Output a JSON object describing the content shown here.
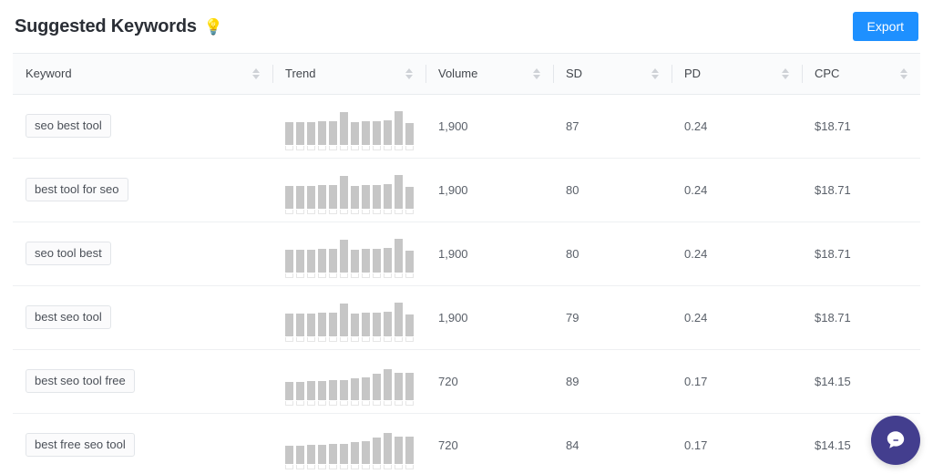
{
  "header": {
    "title": "Suggested Keywords",
    "bulb_icon": "lightbulb-icon",
    "bulb_glyph": "💡",
    "export_label": "Export",
    "export_color": "#1e90ff"
  },
  "table": {
    "columns": [
      {
        "key": "keyword",
        "label": "Keyword",
        "sortable": true
      },
      {
        "key": "trend",
        "label": "Trend",
        "sortable": true
      },
      {
        "key": "volume",
        "label": "Volume",
        "sortable": true
      },
      {
        "key": "sd",
        "label": "SD",
        "sortable": true
      },
      {
        "key": "pd",
        "label": "PD",
        "sortable": true
      },
      {
        "key": "cpc",
        "label": "CPC",
        "sortable": true
      }
    ],
    "rows": [
      {
        "keyword": "seo best tool",
        "volume": "1,900",
        "sd": "87",
        "pd": "0.24",
        "cpc": "$18.71",
        "trend": [
          60,
          60,
          60,
          62,
          62,
          85,
          60,
          62,
          62,
          65,
          88,
          58
        ]
      },
      {
        "keyword": "best tool for seo",
        "volume": "1,900",
        "sd": "80",
        "pd": "0.24",
        "cpc": "$18.71",
        "trend": [
          60,
          60,
          60,
          62,
          62,
          85,
          60,
          62,
          62,
          65,
          88,
          58
        ]
      },
      {
        "keyword": "seo tool best",
        "volume": "1,900",
        "sd": "80",
        "pd": "0.24",
        "cpc": "$18.71",
        "trend": [
          60,
          60,
          60,
          62,
          62,
          85,
          60,
          62,
          62,
          65,
          88,
          58
        ]
      },
      {
        "keyword": "best seo tool",
        "volume": "1,900",
        "sd": "79",
        "pd": "0.24",
        "cpc": "$18.71",
        "trend": [
          60,
          60,
          60,
          62,
          62,
          85,
          60,
          62,
          62,
          65,
          88,
          58
        ]
      },
      {
        "keyword": "best seo tool free",
        "volume": "720",
        "sd": "89",
        "pd": "0.17",
        "cpc": "$14.15",
        "trend": [
          48,
          48,
          50,
          50,
          52,
          52,
          58,
          60,
          68,
          82,
          72,
          72
        ]
      },
      {
        "keyword": "best free seo tool",
        "volume": "720",
        "sd": "84",
        "pd": "0.17",
        "cpc": "$14.15",
        "trend": [
          48,
          48,
          50,
          50,
          52,
          52,
          58,
          60,
          68,
          82,
          72,
          72
        ]
      }
    ]
  },
  "chat_widget": {
    "icon": "chat-bubble-icon",
    "color": "#433e8e"
  },
  "chart_data": {
    "type": "bar",
    "title": "Keyword search volume trend sparklines",
    "xlabel": "",
    "ylabel": "",
    "grid": false,
    "legend": "none",
    "categories": [
      "1",
      "2",
      "3",
      "4",
      "5",
      "6",
      "7",
      "8",
      "9",
      "10",
      "11",
      "12"
    ],
    "series": [
      {
        "name": "seo best tool",
        "values": [
          60,
          60,
          60,
          62,
          62,
          85,
          60,
          62,
          62,
          65,
          88,
          58
        ]
      },
      {
        "name": "best tool for seo",
        "values": [
          60,
          60,
          60,
          62,
          62,
          85,
          60,
          62,
          62,
          65,
          88,
          58
        ]
      },
      {
        "name": "seo tool best",
        "values": [
          60,
          60,
          60,
          62,
          62,
          85,
          60,
          62,
          62,
          65,
          88,
          58
        ]
      },
      {
        "name": "best seo tool",
        "values": [
          60,
          60,
          60,
          62,
          62,
          85,
          60,
          62,
          62,
          65,
          88,
          58
        ]
      },
      {
        "name": "best seo tool free",
        "values": [
          48,
          48,
          50,
          50,
          52,
          52,
          58,
          60,
          68,
          82,
          72,
          72
        ]
      },
      {
        "name": "best free seo tool",
        "values": [
          48,
          48,
          50,
          50,
          52,
          52,
          58,
          60,
          68,
          82,
          72,
          72
        ]
      }
    ],
    "ylim": [
      0,
      100
    ]
  }
}
